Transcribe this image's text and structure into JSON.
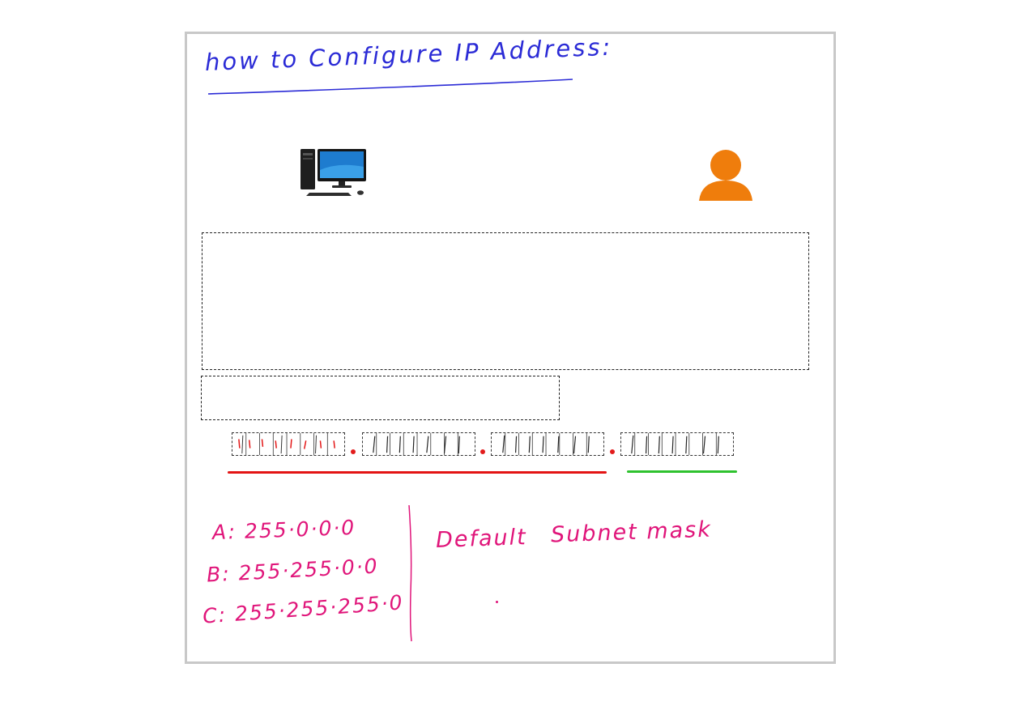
{
  "whiteboard": {
    "title": "how to Configure IP Address:",
    "icons": {
      "computer": "desktop-computer-icon",
      "user": "user-person-icon"
    },
    "colors": {
      "title_ink": "#2b2bd6",
      "notes_ink": "#e0157a",
      "user_icon": "#ef7d0c",
      "network_underline": "#e31414",
      "host_underline": "#2ec22e"
    },
    "ip_octet_separators": [
      ".",
      ".",
      "."
    ],
    "default_masks": [
      "A:  255·0·0·0",
      "B:  255·255·0·0",
      "C:  255·255·255·0"
    ],
    "heading_default": "Default",
    "heading_subnet_mask": "Subnet mask"
  }
}
